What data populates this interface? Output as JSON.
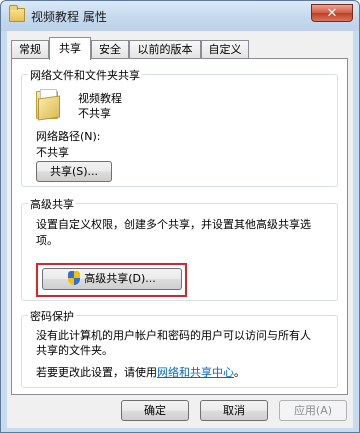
{
  "window": {
    "title": "视频教程 属性",
    "close_symbol": "✕",
    "folder_icon": "folder-icon"
  },
  "tabs": [
    {
      "label": "常规",
      "active": false
    },
    {
      "label": "共享",
      "active": true
    },
    {
      "label": "安全",
      "active": false
    },
    {
      "label": "以前的版本",
      "active": false
    },
    {
      "label": "自定义",
      "active": false
    }
  ],
  "network_sharing": {
    "group_title": "网络文件和文件夹共享",
    "folder_name": "视频教程",
    "folder_status": "不共享",
    "path_label": "网络路径(N):",
    "path_value": "不共享",
    "share_button": "共享(S)..."
  },
  "advanced_sharing": {
    "group_title": "高级共享",
    "description_line1": "设置自定义权限，创建多个共享，并设置其他高级共享选",
    "description_line2": "项。",
    "button_label": "高级共享(D)...",
    "button_icon": "uac-shield-icon",
    "highlight_color": "#d7262b"
  },
  "password_protection": {
    "group_title": "密码保护",
    "description_line1": "没有此计算机的用户帐户和密码的用户可以访问与所有人",
    "description_line2": "共享的文件夹。",
    "change_prefix": "若要更改此设置，请使用",
    "link_text": "网络和共享中心",
    "change_suffix": "。"
  },
  "footer": {
    "ok": "确定",
    "cancel": "取消",
    "apply": "应用(A)"
  }
}
